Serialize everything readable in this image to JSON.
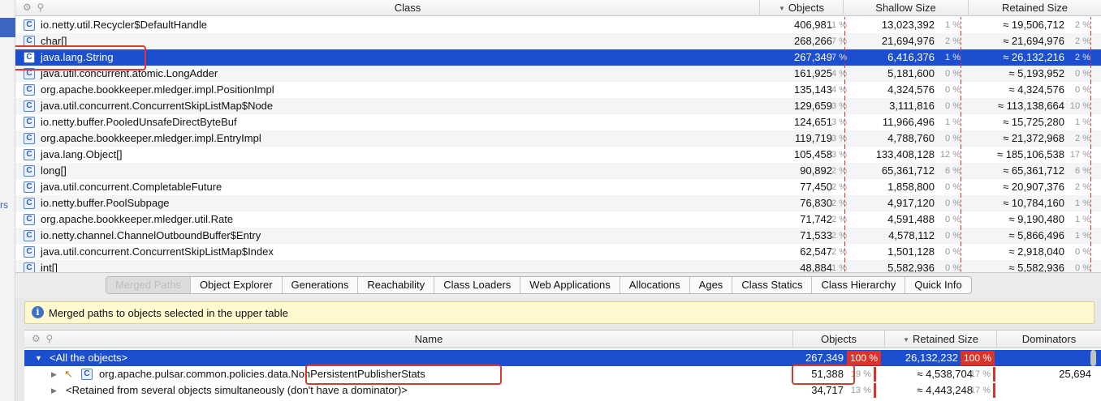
{
  "upper_table": {
    "columns": [
      "Class",
      "Objects",
      "Shallow Size",
      "Retained Size"
    ],
    "rows": [
      {
        "name": "io.netty.util.Recycler$DefaultHandle",
        "objects": "406,981",
        "objects_pct": "11 %",
        "shallow": "13,023,392",
        "shallow_pct": "1 %",
        "retained": "≈ 19,506,712",
        "retained_pct": "2 %"
      },
      {
        "name": "char[]",
        "objects": "268,266",
        "objects_pct": "7 %",
        "shallow": "21,694,976",
        "shallow_pct": "2 %",
        "retained": "≈ 21,694,976",
        "retained_pct": "2 %"
      },
      {
        "name": "java.lang.String",
        "objects": "267,349",
        "objects_pct": "7 %",
        "shallow": "6,416,376",
        "shallow_pct": "1 %",
        "retained": "≈ 26,132,216",
        "retained_pct": "2 %"
      },
      {
        "name": "java.util.concurrent.atomic.LongAdder",
        "objects": "161,925",
        "objects_pct": "4 %",
        "shallow": "5,181,600",
        "shallow_pct": "0 %",
        "retained": "≈ 5,193,952",
        "retained_pct": "0 %"
      },
      {
        "name": "org.apache.bookkeeper.mledger.impl.PositionImpl",
        "objects": "135,143",
        "objects_pct": "4 %",
        "shallow": "4,324,576",
        "shallow_pct": "0 %",
        "retained": "≈ 4,324,576",
        "retained_pct": "0 %"
      },
      {
        "name": "java.util.concurrent.ConcurrentSkipListMap$Node",
        "objects": "129,659",
        "objects_pct": "3 %",
        "shallow": "3,111,816",
        "shallow_pct": "0 %",
        "retained": "≈ 113,138,664",
        "retained_pct": "10 %"
      },
      {
        "name": "io.netty.buffer.PooledUnsafeDirectByteBuf",
        "objects": "124,651",
        "objects_pct": "3 %",
        "shallow": "11,966,496",
        "shallow_pct": "1 %",
        "retained": "≈ 15,725,280",
        "retained_pct": "1 %"
      },
      {
        "name": "org.apache.bookkeeper.mledger.impl.EntryImpl",
        "objects": "119,719",
        "objects_pct": "3 %",
        "shallow": "4,788,760",
        "shallow_pct": "0 %",
        "retained": "≈ 21,372,968",
        "retained_pct": "2 %"
      },
      {
        "name": "java.lang.Object[]",
        "objects": "105,458",
        "objects_pct": "3 %",
        "shallow": "133,408,128",
        "shallow_pct": "12 %",
        "retained": "≈ 185,106,538",
        "retained_pct": "17 %"
      },
      {
        "name": "long[]",
        "objects": "90,892",
        "objects_pct": "2 %",
        "shallow": "65,361,712",
        "shallow_pct": "6 %",
        "retained": "≈ 65,361,712",
        "retained_pct": "6 %"
      },
      {
        "name": "java.util.concurrent.CompletableFuture",
        "objects": "77,450",
        "objects_pct": "2 %",
        "shallow": "1,858,800",
        "shallow_pct": "0 %",
        "retained": "≈ 20,907,376",
        "retained_pct": "2 %"
      },
      {
        "name": "io.netty.buffer.PoolSubpage",
        "objects": "76,830",
        "objects_pct": "2 %",
        "shallow": "4,917,120",
        "shallow_pct": "0 %",
        "retained": "≈ 10,784,160",
        "retained_pct": "1 %"
      },
      {
        "name": "org.apache.bookkeeper.mledger.util.Rate",
        "objects": "71,742",
        "objects_pct": "2 %",
        "shallow": "4,591,488",
        "shallow_pct": "0 %",
        "retained": "≈ 9,190,480",
        "retained_pct": "1 %"
      },
      {
        "name": "io.netty.channel.ChannelOutboundBuffer$Entry",
        "objects": "71,533",
        "objects_pct": "2 %",
        "shallow": "4,578,112",
        "shallow_pct": "0 %",
        "retained": "≈ 5,866,496",
        "retained_pct": "1 %"
      },
      {
        "name": "java.util.concurrent.ConcurrentSkipListMap$Index",
        "objects": "62,547",
        "objects_pct": "2 %",
        "shallow": "1,501,128",
        "shallow_pct": "0 %",
        "retained": "≈ 2,918,040",
        "retained_pct": "0 %"
      },
      {
        "name": "int[]",
        "objects": "48,884",
        "objects_pct": "1 %",
        "shallow": "5,582,936",
        "shallow_pct": "0 %",
        "retained": "≈ 5,582,936",
        "retained_pct": "0 %"
      }
    ],
    "selected_row": 2,
    "class_icon_letter": "C",
    "left_strip_fragment": "rs"
  },
  "tabs": [
    "Merged Paths",
    "Object Explorer",
    "Generations",
    "Reachability",
    "Class Loaders",
    "Web Applications",
    "Allocations",
    "Ages",
    "Class Statics",
    "Class Hierarchy",
    "Quick Info"
  ],
  "active_tab": 0,
  "info_bar": {
    "text": "Merged paths to objects selected in the upper table",
    "icon": "info-icon"
  },
  "lower_table": {
    "columns": [
      "Name",
      "Objects",
      "Retained Size",
      "Dominators"
    ],
    "rows": [
      {
        "name": "<All the objects>",
        "objects": "267,349",
        "objects_pct": "100 %",
        "retained": "26,132,232",
        "retained_pct": "100 %",
        "dominators": ""
      },
      {
        "name_prefix": "org.apache.pulsar.common.policies.data.",
        "name_highlight": "NonPersistentPublisherStats",
        "objects": "51,388",
        "objects_pct": "19 %",
        "retained": "≈ 4,538,704",
        "retained_pct": "17 %",
        "dominators": "25,694"
      },
      {
        "name": "<Retained from several objects simultaneously (don't have a dominator)>",
        "objects": "34,717",
        "objects_pct": "13 %",
        "retained": "≈ 4,443,248",
        "retained_pct": "17 %",
        "dominators": ""
      }
    ]
  },
  "colors": {
    "selection": "#1c4fd0",
    "accent_red": "#d9342b",
    "info_bg": "#fff9d0"
  }
}
